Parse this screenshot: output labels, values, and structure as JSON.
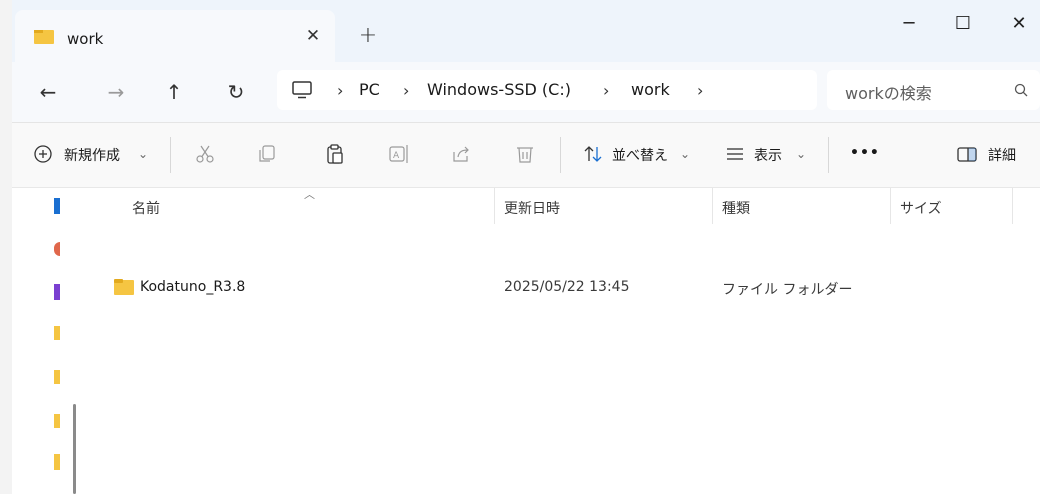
{
  "tab": {
    "label": "work",
    "close_glyph": "✕",
    "new_tab_glyph": "+"
  },
  "window_controls": {
    "minimize": "─",
    "maximize": "☐",
    "close": "✕"
  },
  "nav": {
    "back": "←",
    "forward": "→",
    "up": "↑",
    "refresh": "↻"
  },
  "address": {
    "crumbs": [
      "PC",
      "Windows-SSD (C:)",
      "work"
    ],
    "separator": "›"
  },
  "search": {
    "placeholder": "workの検索"
  },
  "commands": {
    "new": "新規作成",
    "sort": "並べ替え",
    "view": "表示",
    "more": "•••",
    "details": "詳細",
    "dropdown_glyph": "⌄"
  },
  "columns": {
    "name": "名前",
    "modified": "更新日時",
    "type": "種類",
    "size": "サイズ",
    "sort_caret": "︿"
  },
  "files": [
    {
      "name": "Kodatuno_R3.8",
      "modified": "2025/05/22 13:45",
      "type": "ファイル フォルダー",
      "size": ""
    }
  ],
  "colors": {
    "folder": "#f5c542",
    "folder_dark": "#e2a91e",
    "titlebar": "#eef4fb"
  }
}
